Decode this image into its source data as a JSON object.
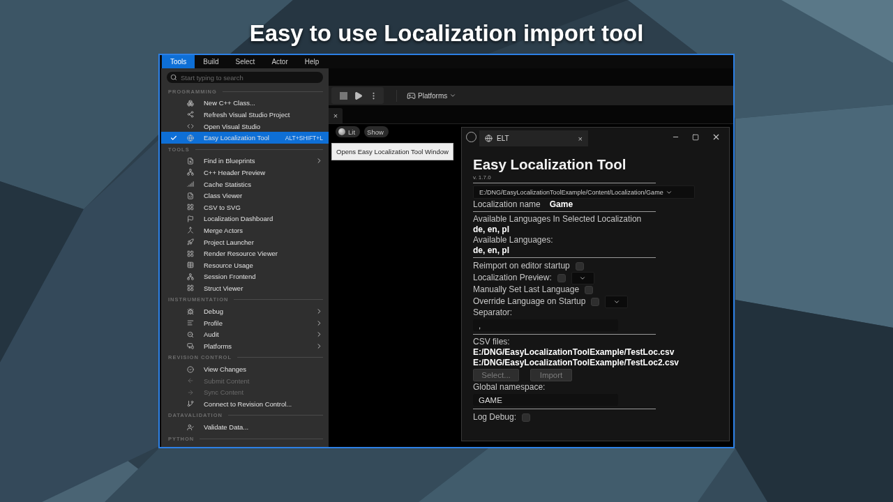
{
  "headline": "Easy to use Localization import tool",
  "menubar": [
    {
      "label": "Tools",
      "selected": true
    },
    {
      "label": "Build",
      "selected": false
    },
    {
      "label": "Select",
      "selected": false
    },
    {
      "label": "Actor",
      "selected": false
    },
    {
      "label": "Help",
      "selected": false
    }
  ],
  "menu": {
    "search_placeholder": "Start typing to search",
    "sections": [
      {
        "title": "PROGRAMMING",
        "items": [
          {
            "label": "New C++ Class...",
            "selected": false,
            "checked": false,
            "disabled": false,
            "submenu": false
          },
          {
            "label": "Refresh Visual Studio Project",
            "selected": false,
            "checked": false,
            "disabled": false,
            "submenu": false
          },
          {
            "label": "Open Visual Studio",
            "selected": false,
            "checked": false,
            "disabled": false,
            "submenu": false
          },
          {
            "label": "Easy Localization Tool",
            "shortcut": "ALT+SHIFT+L",
            "selected": true,
            "checked": true,
            "disabled": false,
            "submenu": false
          }
        ]
      },
      {
        "title": "TOOLS",
        "items": [
          {
            "label": "Find in Blueprints",
            "selected": false,
            "checked": false,
            "disabled": false,
            "submenu": true
          },
          {
            "label": "C++ Header Preview",
            "selected": false,
            "checked": false,
            "disabled": false,
            "submenu": false
          },
          {
            "label": "Cache Statistics",
            "selected": false,
            "checked": false,
            "disabled": false,
            "submenu": false
          },
          {
            "label": "Class Viewer",
            "selected": false,
            "checked": false,
            "disabled": false,
            "submenu": false
          },
          {
            "label": "CSV to SVG",
            "selected": false,
            "checked": false,
            "disabled": false,
            "submenu": false
          },
          {
            "label": "Localization Dashboard",
            "selected": false,
            "checked": false,
            "disabled": false,
            "submenu": false
          },
          {
            "label": "Merge Actors",
            "selected": false,
            "checked": false,
            "disabled": false,
            "submenu": false
          },
          {
            "label": "Project Launcher",
            "selected": false,
            "checked": false,
            "disabled": false,
            "submenu": false
          },
          {
            "label": "Render Resource Viewer",
            "selected": false,
            "checked": false,
            "disabled": false,
            "submenu": false
          },
          {
            "label": "Resource Usage",
            "selected": false,
            "checked": false,
            "disabled": false,
            "submenu": false
          },
          {
            "label": "Session Frontend",
            "selected": false,
            "checked": false,
            "disabled": false,
            "submenu": false
          },
          {
            "label": "Struct Viewer",
            "selected": false,
            "checked": false,
            "disabled": false,
            "submenu": false
          }
        ]
      },
      {
        "title": "INSTRUMENTATION",
        "items": [
          {
            "label": "Debug",
            "selected": false,
            "checked": false,
            "disabled": false,
            "submenu": true
          },
          {
            "label": "Profile",
            "selected": false,
            "checked": false,
            "disabled": false,
            "submenu": true
          },
          {
            "label": "Audit",
            "selected": false,
            "checked": false,
            "disabled": false,
            "submenu": true
          },
          {
            "label": "Platforms",
            "selected": false,
            "checked": false,
            "disabled": false,
            "submenu": true
          }
        ]
      },
      {
        "title": "REVISION CONTROL",
        "items": [
          {
            "label": "View Changes",
            "selected": false,
            "checked": false,
            "disabled": false,
            "submenu": false
          },
          {
            "label": "Submit Content",
            "selected": false,
            "checked": false,
            "disabled": true,
            "submenu": false
          },
          {
            "label": "Sync Content",
            "selected": false,
            "checked": false,
            "disabled": true,
            "submenu": false
          },
          {
            "label": "Connect to Revision Control...",
            "selected": false,
            "checked": false,
            "disabled": false,
            "submenu": false
          }
        ]
      },
      {
        "title": "DATAVALIDATION",
        "items": [
          {
            "label": "Validate Data...",
            "selected": false,
            "checked": false,
            "disabled": false,
            "submenu": false
          }
        ]
      },
      {
        "title": "PYTHON"
      }
    ]
  },
  "toolbar": {
    "platforms": "Platforms"
  },
  "tab_close": "×",
  "viewport": {
    "pills": [
      "Lit",
      "Show"
    ],
    "tooltip": "Opens Easy Localization Tool Window"
  },
  "elt_window": {
    "tab": "ELT",
    "tab_close": "×",
    "body": [
      {
        "kind": "title",
        "text": "Easy Localization Tool"
      },
      {
        "kind": "version",
        "text": "v. 1.7.0"
      },
      {
        "kind": "divider"
      },
      {
        "kind": "dropdown",
        "value": "E:/DNG/EasyLocalizationToolExample/Content/Localization/Game"
      },
      {
        "kind": "pair",
        "label": "Localization name",
        "value": "Game"
      },
      {
        "kind": "divider"
      },
      {
        "kind": "label",
        "text": "Available Languages In Selected Localization"
      },
      {
        "kind": "value",
        "text": "de, en, pl"
      },
      {
        "kind": "label",
        "text": "Available Languages:"
      },
      {
        "kind": "value",
        "text": "de, en, pl"
      },
      {
        "kind": "divider"
      },
      {
        "kind": "toggle",
        "label": "Reimport on editor startup",
        "checked": false,
        "dropdown": false
      },
      {
        "kind": "toggle",
        "label": "Localization Preview:",
        "checked": false,
        "dropdown": true
      },
      {
        "kind": "toggle",
        "label": "Manually Set Last Language",
        "checked": false,
        "dropdown": false
      },
      {
        "kind": "toggle",
        "label": "Override Language on Startup",
        "checked": false,
        "dropdown": true
      },
      {
        "kind": "label",
        "text": "Separator:"
      },
      {
        "kind": "input",
        "value": ","
      },
      {
        "kind": "divider"
      },
      {
        "kind": "label",
        "text": "CSV files:"
      },
      {
        "kind": "value",
        "text": "E:/DNG/EasyLocalizationToolExample/TestLoc.csv"
      },
      {
        "kind": "value",
        "text": "E:/DNG/EasyLocalizationToolExample/TestLoc2.csv"
      },
      {
        "kind": "buttons",
        "buttons": [
          {
            "label": "Select...",
            "disabled": true
          },
          {
            "label": "Import",
            "disabled": true
          }
        ]
      },
      {
        "kind": "label",
        "text": "Global namespace:"
      },
      {
        "kind": "input",
        "value": "GAME"
      },
      {
        "kind": "divider"
      },
      {
        "kind": "toggle",
        "label": "Log Debug:",
        "checked": false,
        "dropdown": false
      }
    ]
  }
}
